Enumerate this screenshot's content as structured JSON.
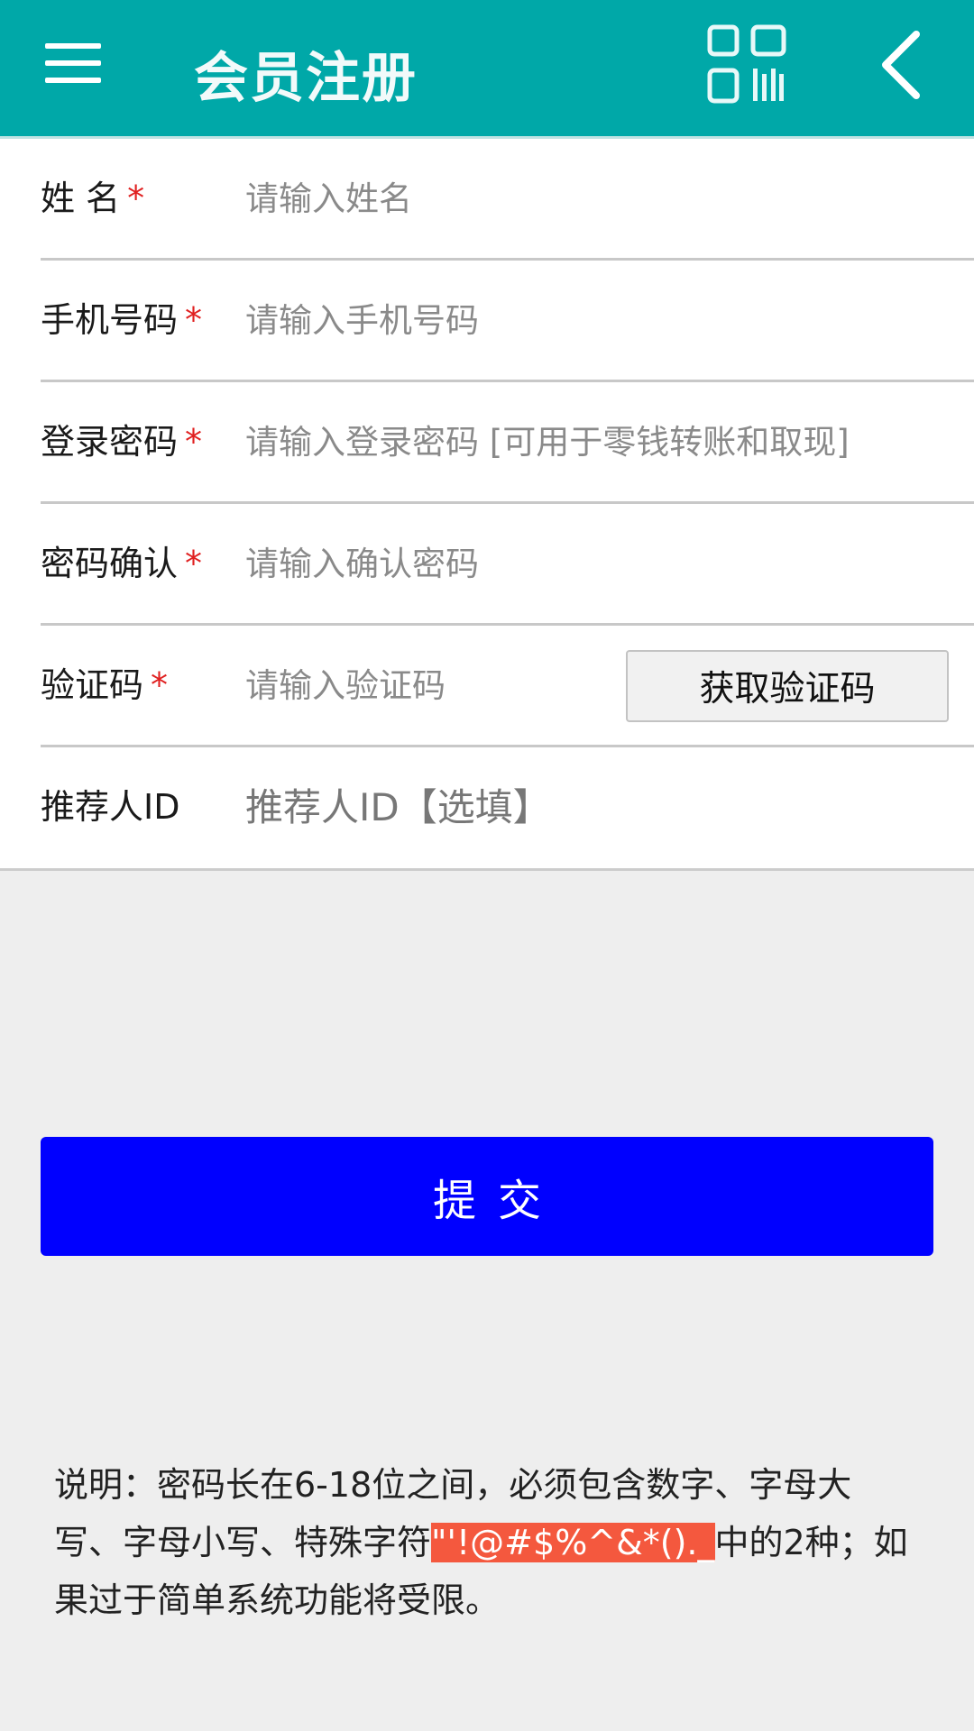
{
  "header": {
    "title": "会员注册",
    "menu_icon": "hamburger-menu-icon",
    "qr_icon": "qr-code-icon",
    "back_icon": "chevron-left-icon",
    "background": "#00a8a8"
  },
  "form": {
    "name": {
      "label": "姓 名",
      "required": "*",
      "placeholder": "请输入姓名"
    },
    "phone": {
      "label": "手机号码",
      "required": "*",
      "placeholder": "请输入手机号码"
    },
    "password": {
      "label": "登录密码",
      "required": "*",
      "placeholder": "请输入登录密码 [可用于零钱转账和取现]"
    },
    "confirm": {
      "label": "密码确认",
      "required": "*",
      "placeholder": "请输入确认密码"
    },
    "code": {
      "label": "验证码",
      "required": "*",
      "placeholder": "请输入验证码",
      "button": "获取验证码"
    },
    "referrer": {
      "label": "推荐人ID",
      "placeholder": "推荐人ID【选填】"
    }
  },
  "submit": {
    "label": "提交",
    "color": "#0000ff"
  },
  "note": {
    "prefix": "说明：密码长在6-18位之间，必须包含数字、字母大写、字母小写、特殊字符",
    "highlight": "\"'!@#$%^&*()._",
    "suffix": "中的2种；如果过于简单系统功能将受限。",
    "highlight_color": "#f4583e"
  }
}
